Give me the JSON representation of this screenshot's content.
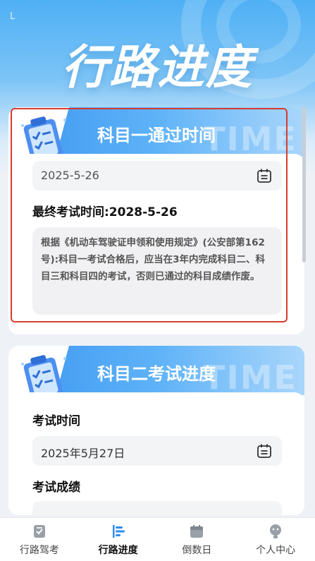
{
  "header": {
    "status_mark": "L",
    "title": "行路进度"
  },
  "card1": {
    "banner_title": "科目一通过时间",
    "banner_watermark": "TIME",
    "pass_date": "2025-5-26",
    "deadline_label": "最终考试时间:2028-5-26",
    "rule_text": "根据《机动车驾驶证申领和使用规定》(公安部第162号):科目一考试合格后，应当在3年内完成科目二、科目三和科目四的考试，否则已通过的科目成绩作废。"
  },
  "card2": {
    "banner_title": "科目二考试进度",
    "banner_watermark": "TIME",
    "exam_time_label": "考试时间",
    "exam_date": "2025年5月27日",
    "score_label": "考试成绩"
  },
  "tabbar": {
    "items": [
      {
        "label": "行路驾考",
        "icon": "checklist-icon",
        "active": false
      },
      {
        "label": "行路进度",
        "icon": "progress-icon",
        "active": true
      },
      {
        "label": "倒数日",
        "icon": "calendar-icon",
        "active": false
      },
      {
        "label": "个人中心",
        "icon": "person-icon",
        "active": false
      }
    ]
  },
  "colors": {
    "accent": "#3d97f0",
    "highlight": "#d63c2e"
  }
}
